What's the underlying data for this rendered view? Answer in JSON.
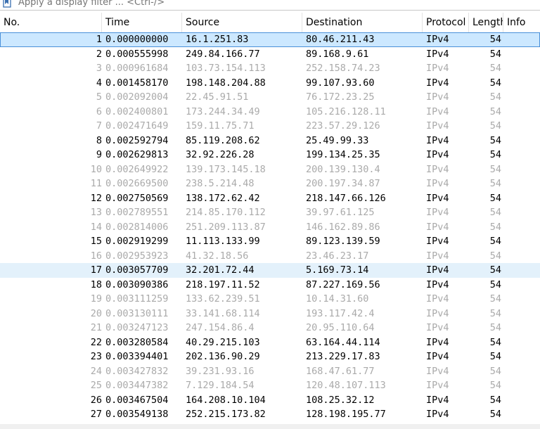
{
  "filter": {
    "placeholder": "Apply a display filter ... <Ctrl-/>"
  },
  "columns": {
    "no": "No.",
    "time": "Time",
    "source": "Source",
    "destination": "Destination",
    "protocol": "Protocol",
    "length": "Length",
    "info": "Info"
  },
  "packets": [
    {
      "no": "1",
      "time": "0.000000000",
      "source": "16.1.251.83",
      "destination": "80.46.211.43",
      "protocol": "IPv4",
      "length": "54",
      "state": "selected"
    },
    {
      "no": "2",
      "time": "0.000555998",
      "source": "249.84.166.77",
      "destination": "89.168.9.61",
      "protocol": "IPv4",
      "length": "54",
      "state": "normal"
    },
    {
      "no": "3",
      "time": "0.000961684",
      "source": "103.73.154.113",
      "destination": "252.158.74.23",
      "protocol": "IPv4",
      "length": "54",
      "state": "faded"
    },
    {
      "no": "4",
      "time": "0.001458170",
      "source": "198.148.204.88",
      "destination": "99.107.93.60",
      "protocol": "IPv4",
      "length": "54",
      "state": "normal"
    },
    {
      "no": "5",
      "time": "0.002092004",
      "source": "22.45.91.51",
      "destination": "76.172.23.25",
      "protocol": "IPv4",
      "length": "54",
      "state": "faded"
    },
    {
      "no": "6",
      "time": "0.002400801",
      "source": "173.244.34.49",
      "destination": "105.216.128.11",
      "protocol": "IPv4",
      "length": "54",
      "state": "faded"
    },
    {
      "no": "7",
      "time": "0.002471649",
      "source": "159.11.75.71",
      "destination": "223.57.29.126",
      "protocol": "IPv4",
      "length": "54",
      "state": "faded"
    },
    {
      "no": "8",
      "time": "0.002592794",
      "source": "85.119.208.62",
      "destination": "25.49.99.33",
      "protocol": "IPv4",
      "length": "54",
      "state": "normal"
    },
    {
      "no": "9",
      "time": "0.002629813",
      "source": "32.92.226.28",
      "destination": "199.134.25.35",
      "protocol": "IPv4",
      "length": "54",
      "state": "normal"
    },
    {
      "no": "10",
      "time": "0.002649922",
      "source": "139.173.145.18",
      "destination": "200.139.130.4",
      "protocol": "IPv4",
      "length": "54",
      "state": "faded"
    },
    {
      "no": "11",
      "time": "0.002669500",
      "source": "238.5.214.48",
      "destination": "200.197.34.87",
      "protocol": "IPv4",
      "length": "54",
      "state": "faded"
    },
    {
      "no": "12",
      "time": "0.002750569",
      "source": "138.172.62.42",
      "destination": "218.147.66.126",
      "protocol": "IPv4",
      "length": "54",
      "state": "normal"
    },
    {
      "no": "13",
      "time": "0.002789551",
      "source": "214.85.170.112",
      "destination": "39.97.61.125",
      "protocol": "IPv4",
      "length": "54",
      "state": "faded"
    },
    {
      "no": "14",
      "time": "0.002814006",
      "source": "251.209.113.87",
      "destination": "146.162.89.86",
      "protocol": "IPv4",
      "length": "54",
      "state": "faded"
    },
    {
      "no": "15",
      "time": "0.002919299",
      "source": "11.113.133.99",
      "destination": "89.123.139.59",
      "protocol": "IPv4",
      "length": "54",
      "state": "normal"
    },
    {
      "no": "16",
      "time": "0.002953923",
      "source": "41.32.18.56",
      "destination": "23.46.23.17",
      "protocol": "IPv4",
      "length": "54",
      "state": "faded"
    },
    {
      "no": "17",
      "time": "0.003057709",
      "source": "32.201.72.44",
      "destination": "5.169.73.14",
      "protocol": "IPv4",
      "length": "54",
      "state": "highlight"
    },
    {
      "no": "18",
      "time": "0.003090386",
      "source": "218.197.11.52",
      "destination": "87.227.169.56",
      "protocol": "IPv4",
      "length": "54",
      "state": "normal"
    },
    {
      "no": "19",
      "time": "0.003111259",
      "source": "133.62.239.51",
      "destination": "10.14.31.60",
      "protocol": "IPv4",
      "length": "54",
      "state": "faded"
    },
    {
      "no": "20",
      "time": "0.003130111",
      "source": "33.141.68.114",
      "destination": "193.117.42.4",
      "protocol": "IPv4",
      "length": "54",
      "state": "faded"
    },
    {
      "no": "21",
      "time": "0.003247123",
      "source": "247.154.86.4",
      "destination": "20.95.110.64",
      "protocol": "IPv4",
      "length": "54",
      "state": "faded"
    },
    {
      "no": "22",
      "time": "0.003280584",
      "source": "40.29.215.103",
      "destination": "63.164.44.114",
      "protocol": "IPv4",
      "length": "54",
      "state": "normal"
    },
    {
      "no": "23",
      "time": "0.003394401",
      "source": "202.136.90.29",
      "destination": "213.229.17.83",
      "protocol": "IPv4",
      "length": "54",
      "state": "normal"
    },
    {
      "no": "24",
      "time": "0.003427832",
      "source": "39.231.93.16",
      "destination": "168.47.61.77",
      "protocol": "IPv4",
      "length": "54",
      "state": "faded"
    },
    {
      "no": "25",
      "time": "0.003447382",
      "source": "7.129.184.54",
      "destination": "120.48.107.113",
      "protocol": "IPv4",
      "length": "54",
      "state": "faded"
    },
    {
      "no": "26",
      "time": "0.003467504",
      "source": "164.208.10.104",
      "destination": "108.25.32.12",
      "protocol": "IPv4",
      "length": "54",
      "state": "normal"
    },
    {
      "no": "27",
      "time": "0.003549138",
      "source": "252.215.173.82",
      "destination": "128.198.195.77",
      "protocol": "IPv4",
      "length": "54",
      "state": "normal"
    }
  ]
}
